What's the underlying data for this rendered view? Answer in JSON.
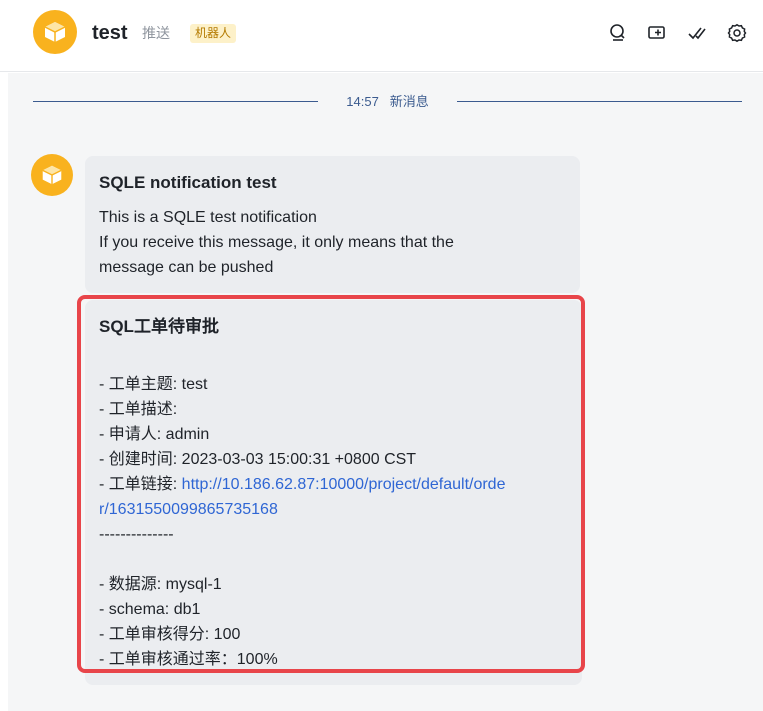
{
  "header": {
    "title": "test",
    "subtitle": "推送",
    "badge": "机器人"
  },
  "divider": {
    "time": "14:57",
    "label": "新消息"
  },
  "message1": {
    "title": "SQLE notification test",
    "line1": "This is a SQLE test notification",
    "line2": "If you receive this message, it only means that the",
    "line3": "message can be pushed"
  },
  "message2": {
    "title": "SQL工单待审批",
    "subject": "- 工单主题: test",
    "description": "- 工单描述:",
    "applicant": "- 申请人: admin",
    "created": "- 创建时间: 2023-03-03 15:00:31 +0800 CST",
    "link_prefix": "- 工单链接: ",
    "link_part1": "http://10.186.62.87:10000/project/default/orde",
    "link_part2": "r/1631550099865735168",
    "separator": "--------------",
    "datasource": "- 数据源: mysql-1",
    "schema": "- schema: db1",
    "score": "- 工单审核得分: 100",
    "pass_rate": "- 工单审核通过率：100%"
  },
  "colors": {
    "accent": "#f9b21e",
    "link": "#2f66d4",
    "highlight": "#e8454a",
    "divider": "#3b5b8f"
  },
  "icons": [
    "robot-box-icon",
    "search-icon",
    "add-screen-icon",
    "check-icon",
    "settings-icon"
  ]
}
